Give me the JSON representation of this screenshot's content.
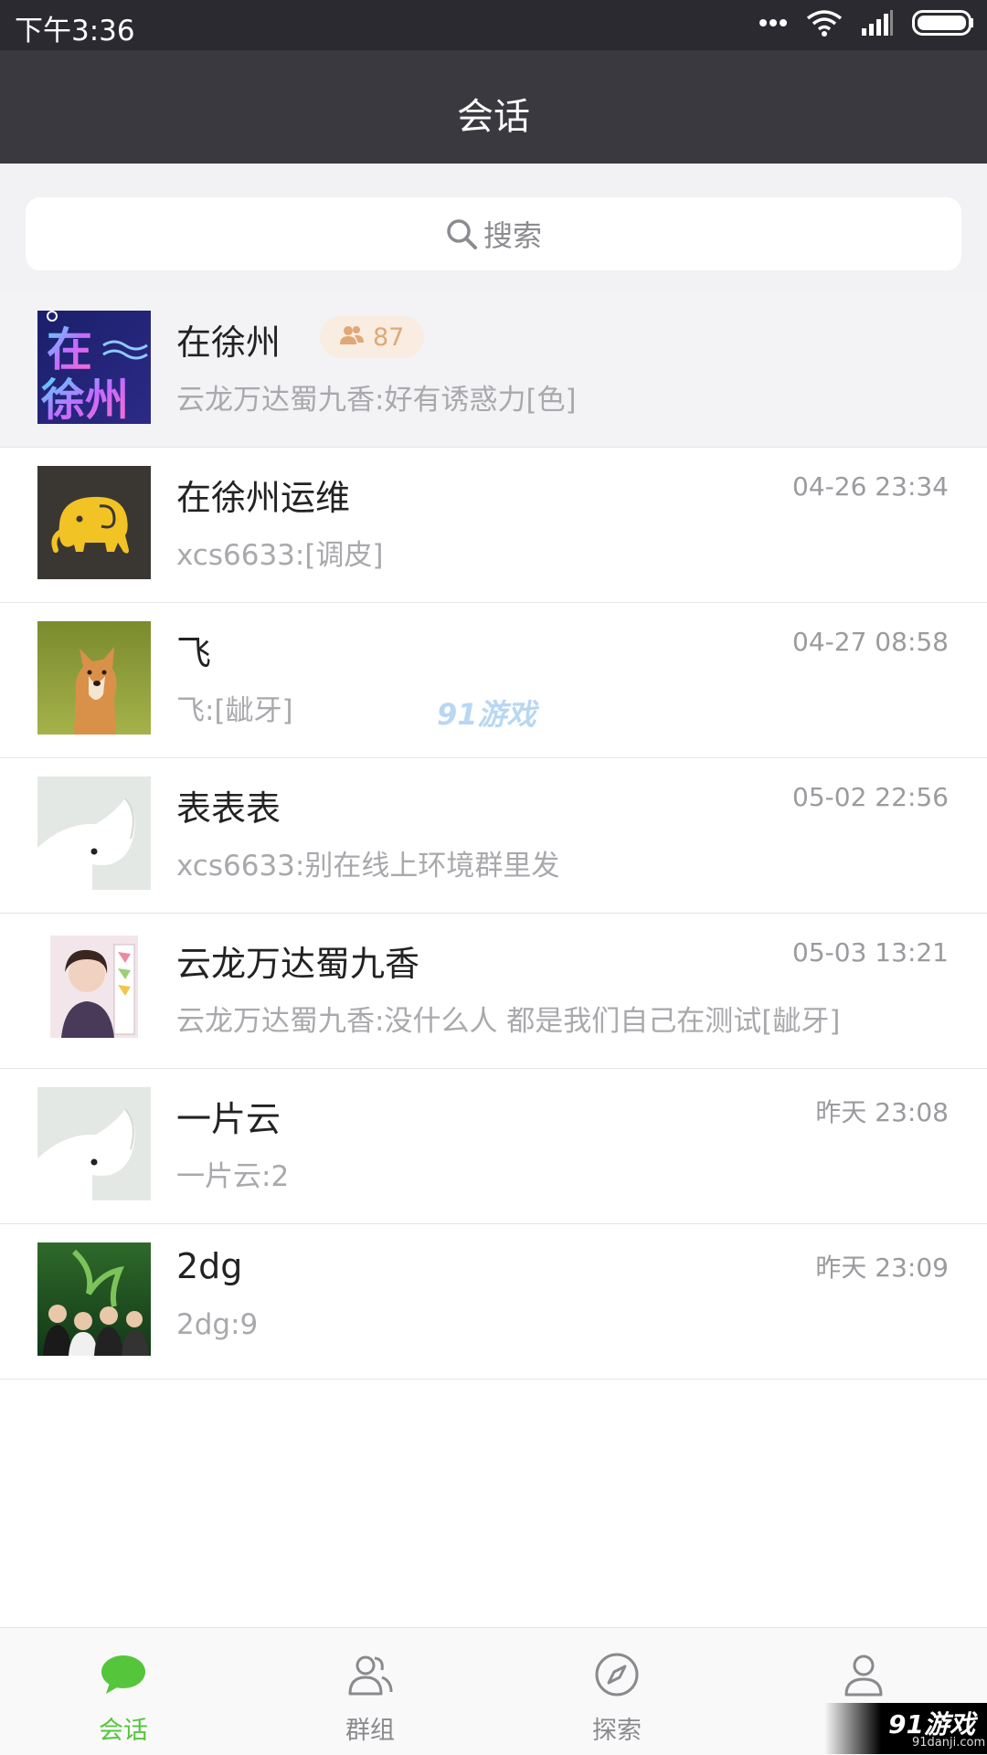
{
  "status_bar": {
    "time": "下午3:36"
  },
  "nav": {
    "title": "会话"
  },
  "search": {
    "placeholder": "搜索"
  },
  "conversations": [
    {
      "name": "在徐州",
      "member_count": "87",
      "time": "",
      "preview": "云龙万达蜀九香:好有诱惑力[色]",
      "pinned": true,
      "avatar": "group-avatar-zaixuzhou",
      "avatar_text_top": "在",
      "avatar_text_bottom": "徐州"
    },
    {
      "name": "在徐州运维",
      "time": "04-26 23:34",
      "preview": "xcs6633:[调皮]",
      "avatar": "elephant-yellow-avatar"
    },
    {
      "name": "飞",
      "time": "04-27 08:58",
      "preview": "飞:[龇牙]",
      "avatar": "shiba-dog-avatar"
    },
    {
      "name": "表表表",
      "time": "05-02 22:56",
      "preview": "xcs6633:别在线上环境群里发",
      "avatar": "elephant-default-avatar"
    },
    {
      "name": "云龙万达蜀九香",
      "time": "05-03 13:21",
      "preview": "云龙万达蜀九香:没什么人 都是我们自己在测试[龇牙]",
      "avatar": "photo-avatar"
    },
    {
      "name": "一片云",
      "time": "昨天 23:08",
      "preview": "一片云:2",
      "avatar": "elephant-default-avatar"
    },
    {
      "name": "2dg",
      "time": "昨天 23:09",
      "preview": "2dg:9",
      "avatar": "movie-poster-avatar"
    }
  ],
  "tabs": [
    {
      "label": "会话",
      "icon": "chat-bubble-icon",
      "active": true
    },
    {
      "label": "群组",
      "icon": "group-users-icon",
      "active": false
    },
    {
      "label": "探索",
      "icon": "compass-icon",
      "active": false
    },
    {
      "label": "",
      "icon": "person-icon",
      "active": false
    }
  ],
  "watermark": {
    "mid_text": "91游戏",
    "corner_logo": "91游戏",
    "corner_url": "91danji.com"
  },
  "colors": {
    "accent_green": "#55c63b",
    "nav_bg": "#3a3940",
    "status_bg": "#2a2a30",
    "badge_text": "#e0a878"
  }
}
